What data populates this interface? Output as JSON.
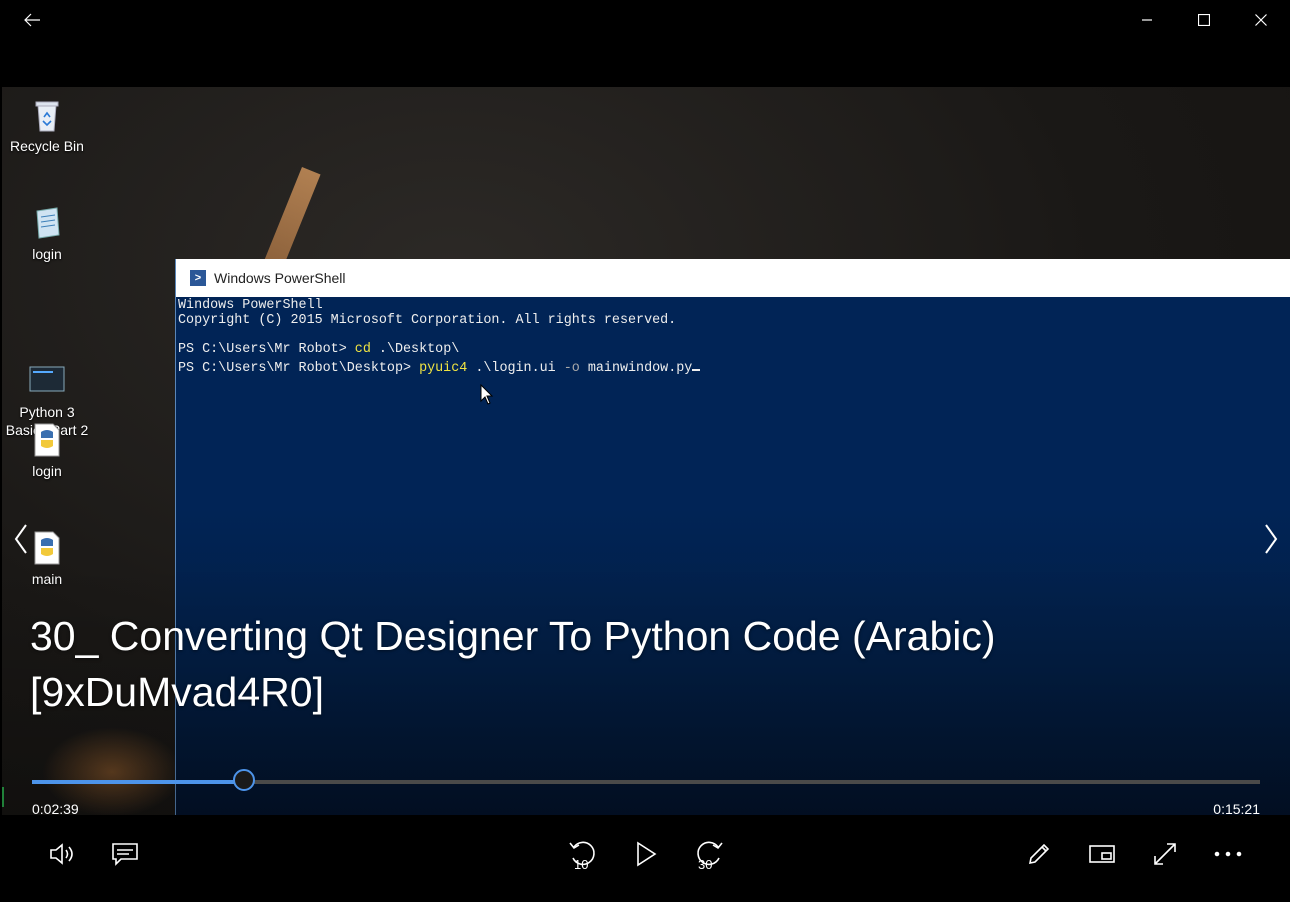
{
  "window": {
    "back_icon": "back-arrow-icon",
    "minimize_icon": "minimize-icon",
    "maximize_icon": "maximize-icon",
    "close_icon": "close-icon"
  },
  "desktop": {
    "icons": [
      {
        "label": "Recycle Bin",
        "icon": "recycle-bin-icon"
      },
      {
        "label": "login",
        "icon": "notepad-file-icon"
      },
      {
        "label": "Python 3\nBasics Part 2",
        "icon": "video-file-icon"
      },
      {
        "label": "login",
        "icon": "python-file-icon"
      },
      {
        "label": "main",
        "icon": "python-file-icon"
      }
    ]
  },
  "powershell": {
    "title": "Windows PowerShell",
    "line1": "Windows PowerShell",
    "line2": "Copyright (C) 2015 Microsoft Corporation. All rights reserved.",
    "line3_prompt": "PS C:\\Users\\Mr Robot> ",
    "line3_cmd": "cd",
    "line3_args": " .\\Desktop\\",
    "line4_prompt": "PS C:\\Users\\Mr Robot\\Desktop> ",
    "line4_cmd": "pyuic4",
    "line4_arg1": " .\\login.ui ",
    "line4_flag": "-o",
    "line4_arg2": " mainwindow.py"
  },
  "video": {
    "title_line1": "30_ Converting Qt Designer To Python Code (Arabic)",
    "title_line2": "[9xDuMvad4R0]",
    "current_time": "0:02:39",
    "total_time": "0:15:21",
    "progress_fraction": 0.1727
  },
  "controls": {
    "skip_back_label": "10",
    "skip_forward_label": "30"
  },
  "colors": {
    "accent": "#4d94ea",
    "powershell_bg": "#012456"
  }
}
